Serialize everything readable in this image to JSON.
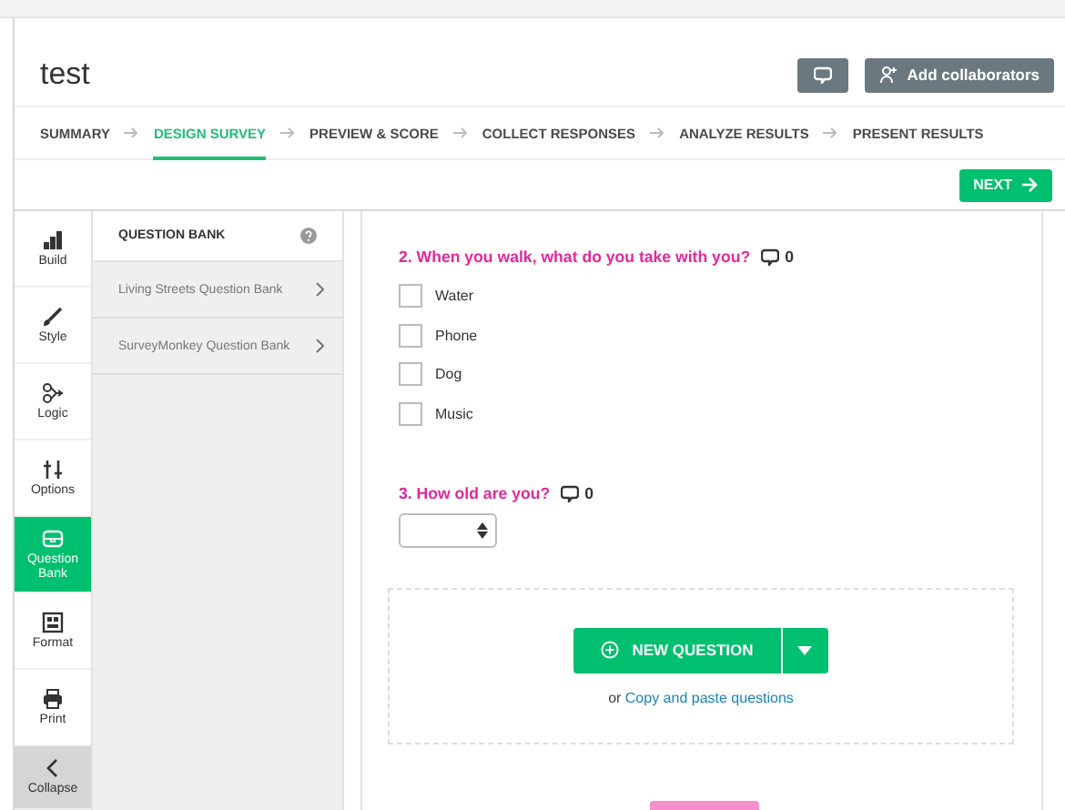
{
  "header": {
    "title": "test",
    "buttons": [
      {
        "kind": "comment"
      },
      {
        "kind": "collaborators",
        "label": "Add collaborators"
      }
    ]
  },
  "steps": [
    {
      "label": "SUMMARY",
      "selected": false
    },
    {
      "label": "DESIGN SURVEY",
      "selected": true
    },
    {
      "label": "PREVIEW & SCORE",
      "selected": false
    },
    {
      "label": "COLLECT RESPONSES",
      "selected": false
    },
    {
      "label": "ANALYZE RESULTS",
      "selected": false
    },
    {
      "label": "PRESENT RESULTS",
      "selected": false
    }
  ],
  "next_button": "NEXT",
  "sidebar": {
    "items": [
      {
        "kind": "build",
        "label": "Build",
        "selected": false
      },
      {
        "kind": "style",
        "label": "Style",
        "selected": false
      },
      {
        "kind": "logic",
        "label": "Logic",
        "selected": false
      },
      {
        "kind": "options",
        "label": "Options",
        "selected": false
      },
      {
        "kind": "bank",
        "label": "Question Bank",
        "selected": true
      },
      {
        "kind": "format",
        "label": "Format",
        "selected": false
      },
      {
        "kind": "print",
        "label": "Print",
        "selected": false
      },
      {
        "kind": "collapse",
        "label": "Collapse",
        "selected": false
      }
    ]
  },
  "panel": {
    "title": "QUESTION BANK",
    "items": [
      "Living Streets Question Bank",
      "SurveyMonkey Question Bank"
    ]
  },
  "questions": [
    {
      "kind": "checkboxes",
      "title": "2. When you walk, what do you take with you?",
      "comments": "0",
      "options": [
        {
          "label": "Water",
          "checked": false
        },
        {
          "label": "Phone",
          "checked": false
        },
        {
          "label": "Dog",
          "checked": false
        },
        {
          "label": "Music",
          "checked": false
        }
      ]
    },
    {
      "kind": "dropdown",
      "title": "3. How old are you?",
      "comments": "0"
    }
  ],
  "add_question": {
    "button": "NEW QUESTION",
    "prefix": "or",
    "link": "Copy and paste questions"
  }
}
